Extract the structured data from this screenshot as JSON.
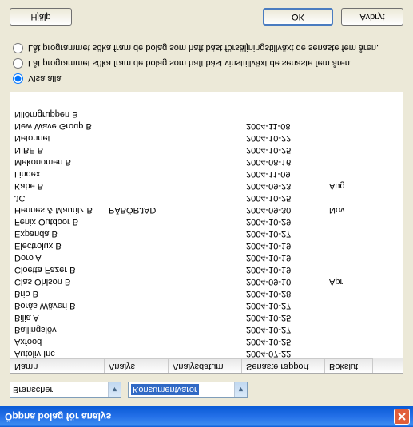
{
  "title": "Öppna bolag för analys",
  "combo1_label": "Branscher",
  "combo2_value": "Konsumentvaror",
  "columns": {
    "name": "Namn",
    "analys": "Analys",
    "analysdatum": "Analysdatum",
    "senaste": "Senaste rapport",
    "bokslut": "Bokslut"
  },
  "rows": [
    {
      "name": "Autoliv Inc",
      "analys": "",
      "date": "",
      "rapport": "2004-07-22",
      "bokslut": ""
    },
    {
      "name": "Axfood",
      "analys": "",
      "date": "",
      "rapport": "2004-10-25",
      "bokslut": ""
    },
    {
      "name": "Ballingslöv",
      "analys": "",
      "date": "",
      "rapport": "2004-10-27",
      "bokslut": ""
    },
    {
      "name": "Bilia A",
      "analys": "",
      "date": "",
      "rapport": "2004-10-25",
      "bokslut": ""
    },
    {
      "name": "Borås Wäveri B",
      "analys": "",
      "date": "",
      "rapport": "2004-10-27",
      "bokslut": ""
    },
    {
      "name": "Brio B",
      "analys": "",
      "date": "",
      "rapport": "2004-10-28",
      "bokslut": ""
    },
    {
      "name": "Clas Ohlson B",
      "analys": "",
      "date": "",
      "rapport": "2004-09-10",
      "bokslut": "Apr"
    },
    {
      "name": "Cloetta Fazer B",
      "analys": "",
      "date": "",
      "rapport": "2004-10-19",
      "bokslut": ""
    },
    {
      "name": "Doro A",
      "analys": "",
      "date": "",
      "rapport": "2004-10-19",
      "bokslut": ""
    },
    {
      "name": "Electrolux B",
      "analys": "",
      "date": "",
      "rapport": "2004-10-19",
      "bokslut": ""
    },
    {
      "name": "Expanda B",
      "analys": "",
      "date": "",
      "rapport": "2004-10-27",
      "bokslut": ""
    },
    {
      "name": "Fenix Outdoor B",
      "analys": "",
      "date": "",
      "rapport": "2004-10-29",
      "bokslut": ""
    },
    {
      "name": "Hennes & Mauritz B",
      "analys": "PÅBÖRJAD",
      "date": "",
      "rapport": "2004-09-30",
      "bokslut": "Nov"
    },
    {
      "name": "JC",
      "analys": "",
      "date": "",
      "rapport": "2004-10-25",
      "bokslut": ""
    },
    {
      "name": "Kabe B",
      "analys": "",
      "date": "",
      "rapport": "2004-09-23",
      "bokslut": "Aug"
    },
    {
      "name": "Lindex",
      "analys": "",
      "date": "",
      "rapport": "2004-11-09",
      "bokslut": ""
    },
    {
      "name": "Mekonomen B",
      "analys": "",
      "date": "",
      "rapport": "2004-08-16",
      "bokslut": ""
    },
    {
      "name": "NIBE B",
      "analys": "",
      "date": "",
      "rapport": "2004-10-25",
      "bokslut": ""
    },
    {
      "name": "Netonnet",
      "analys": "",
      "date": "",
      "rapport": "2004-10-22",
      "bokslut": ""
    },
    {
      "name": "New Wave Group B",
      "analys": "",
      "date": "",
      "rapport": "2004-11-08",
      "bokslut": ""
    },
    {
      "name": "Nilörngruppen B",
      "analys": "",
      "date": "",
      "rapport": "",
      "bokslut": ""
    }
  ],
  "radio1": "Visa alla",
  "radio2": "Låt programmet söka fram de bolag som haft bäst vinsttillväxt de senaste fem åren.",
  "radio3": "Låt programmet söka fram de bolag som haft bäst försäljningstillväxt de senaste fem åren.",
  "buttons": {
    "help": "Hjälp",
    "ok": "OK",
    "cancel": "Avbryt"
  }
}
